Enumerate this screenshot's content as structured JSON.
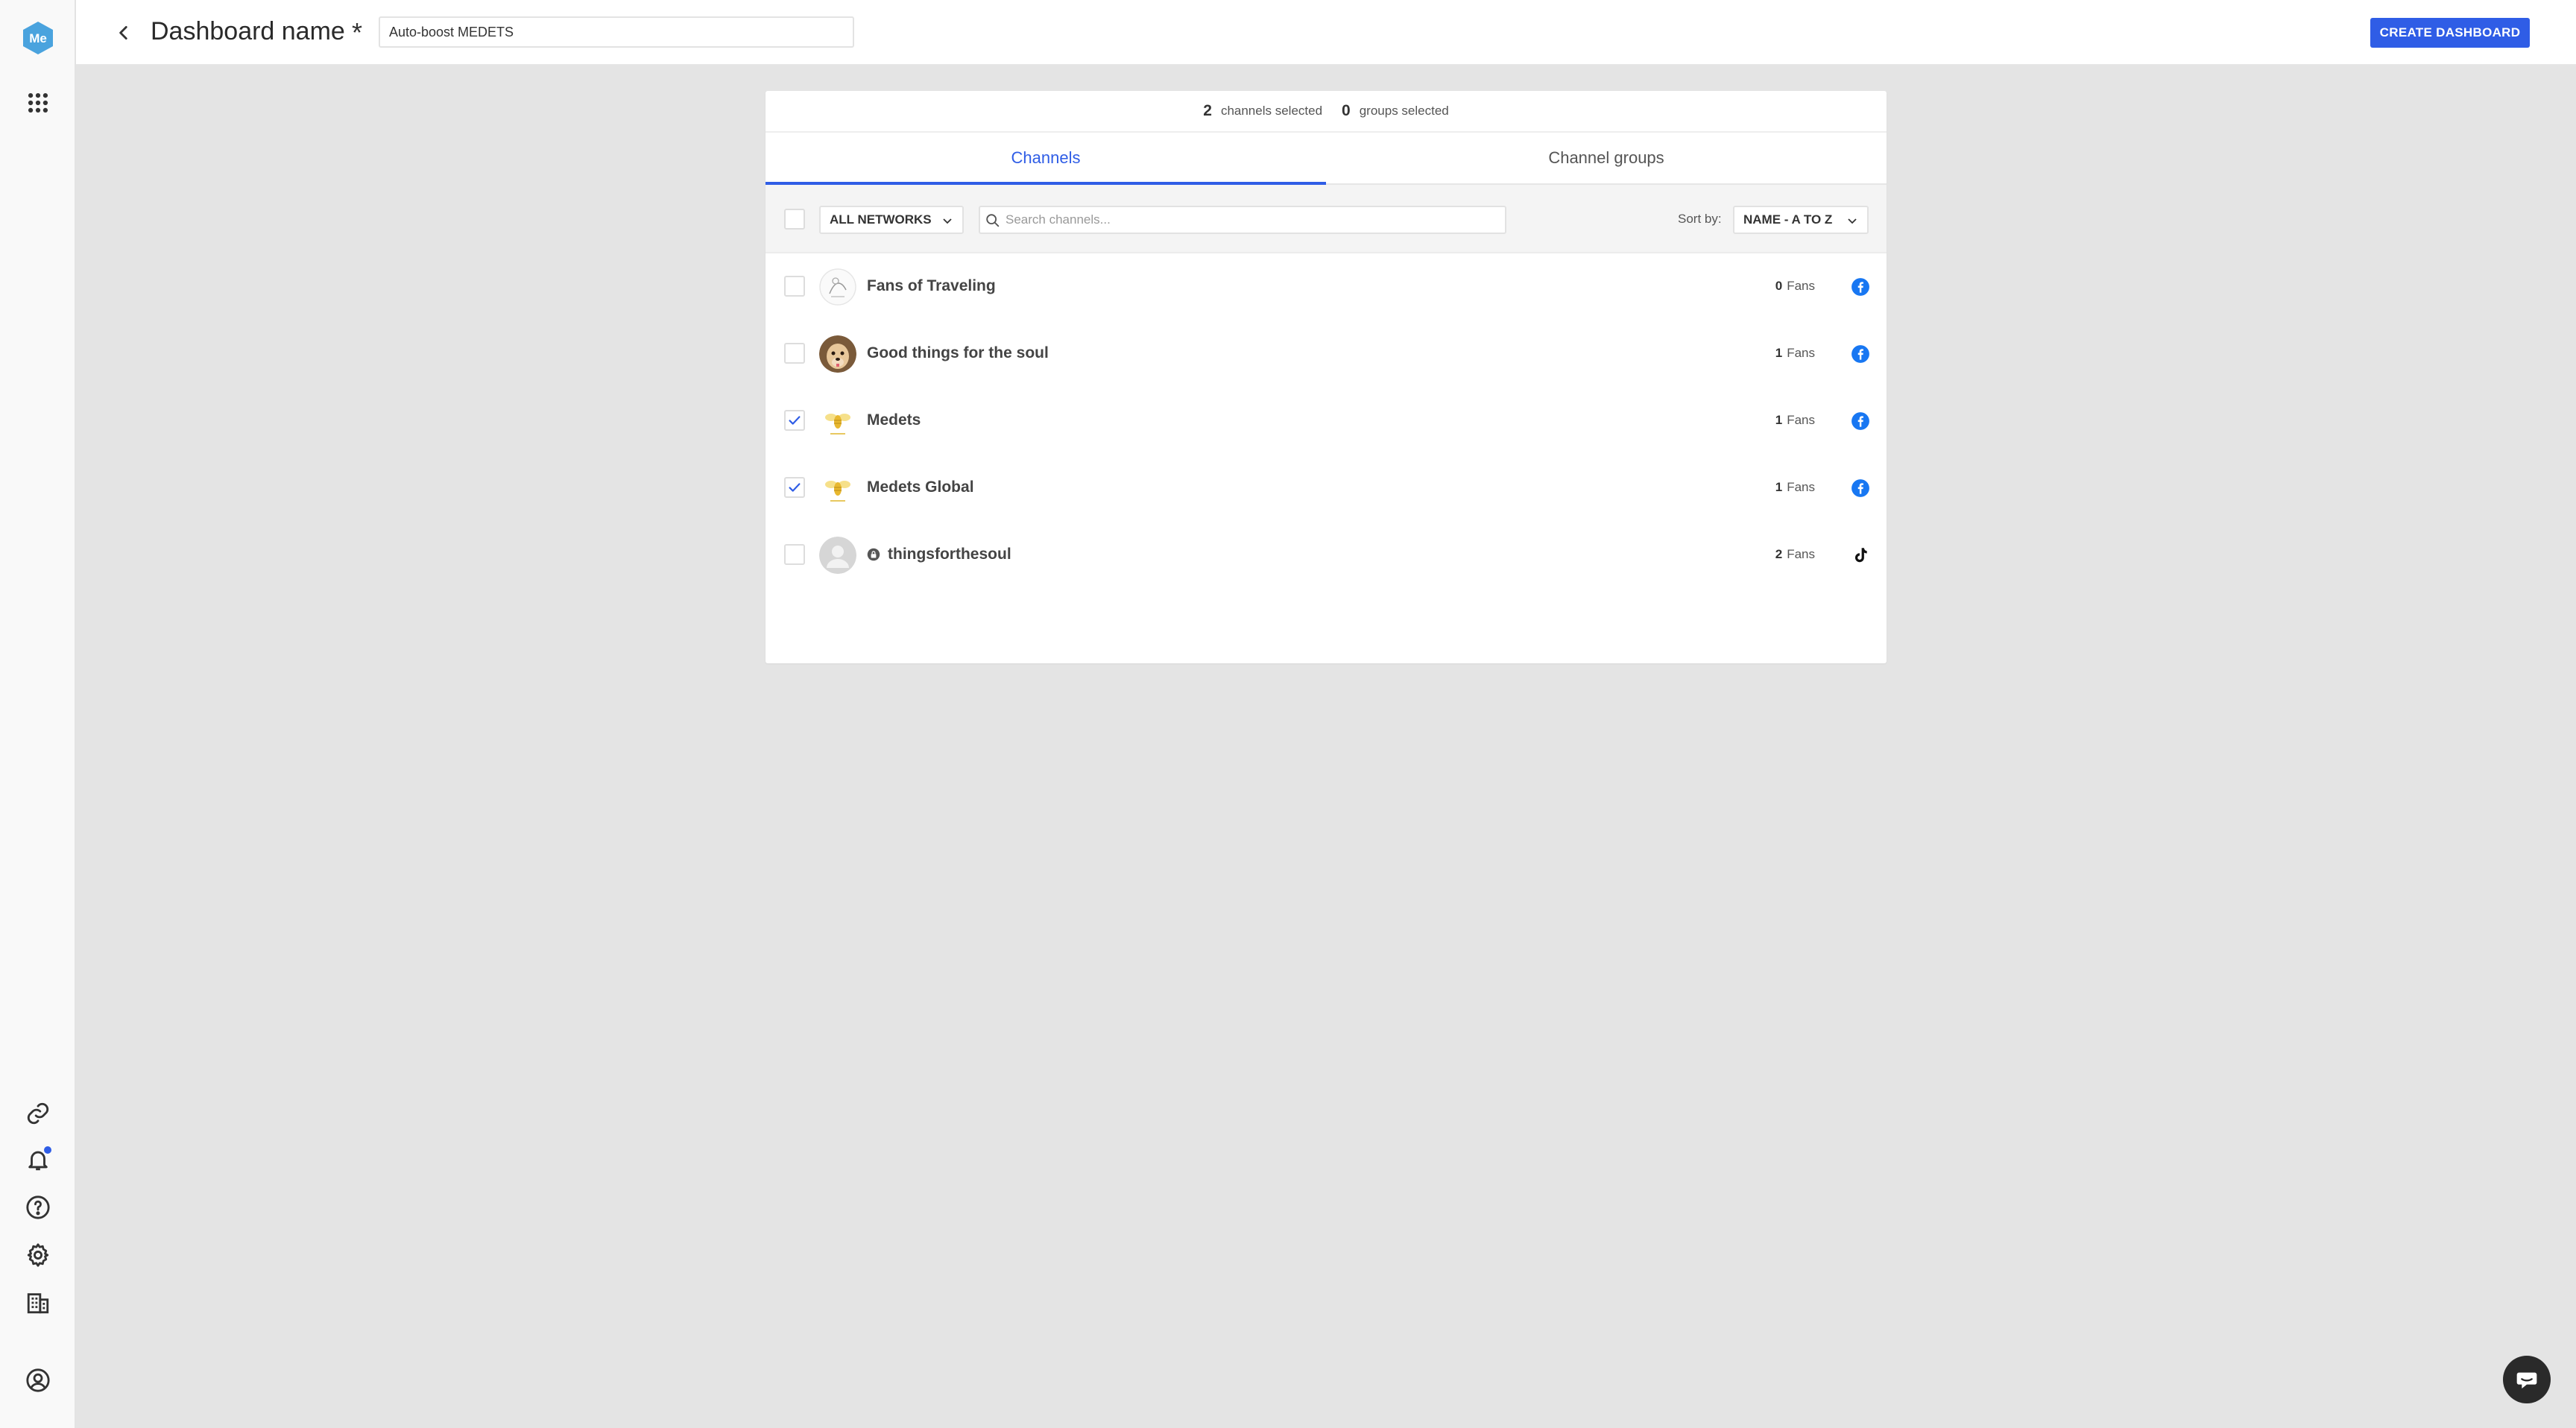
{
  "app": {
    "logo_text": "Me",
    "colors": {
      "accent": "#2f5de6",
      "logo": "#4aa3de",
      "facebook": "#1877f2"
    }
  },
  "sidebar": {
    "top_icons": [
      "apps-grid-icon"
    ],
    "bottom_icons": [
      "link-icon",
      "bell-icon",
      "help-icon",
      "gear-icon",
      "building-icon",
      "account-icon"
    ]
  },
  "header": {
    "title": "Dashboard name",
    "required_mark": "*",
    "name_value": "Auto-boost MEDETS",
    "create_label": "CREATE DASHBOARD"
  },
  "summary": {
    "channels_count": "2",
    "channels_label": "channels selected",
    "groups_count": "0",
    "groups_label": "groups selected"
  },
  "tabs": [
    {
      "label": "Channels",
      "active": true
    },
    {
      "label": "Channel groups",
      "active": false
    }
  ],
  "toolbar": {
    "network_filter": "ALL NETWORKS",
    "search_placeholder": "Search channels...",
    "sort_label": "Sort by:",
    "sort_value": "NAME - A TO Z"
  },
  "channels": [
    {
      "name": "Fans of Traveling",
      "fans_count": "0",
      "fans_label": "Fans",
      "network": "facebook-icon",
      "checked": false,
      "avatar": "sketch-avatar",
      "locked": false
    },
    {
      "name": "Good things for the soul",
      "fans_count": "1",
      "fans_label": "Fans",
      "network": "facebook-icon",
      "checked": false,
      "avatar": "dog-photo-avatar",
      "locked": false
    },
    {
      "name": "Medets",
      "fans_count": "1",
      "fans_label": "Fans",
      "network": "facebook-icon",
      "checked": true,
      "avatar": "bee-logo-avatar",
      "locked": false
    },
    {
      "name": "Medets Global",
      "fans_count": "1",
      "fans_label": "Fans",
      "network": "facebook-icon",
      "checked": true,
      "avatar": "bee-logo-avatar",
      "locked": false
    },
    {
      "name": "thingsforthesoul",
      "fans_count": "2",
      "fans_label": "Fans",
      "network": "tiktok-icon",
      "checked": false,
      "avatar": "default-user-avatar",
      "locked": true
    }
  ]
}
